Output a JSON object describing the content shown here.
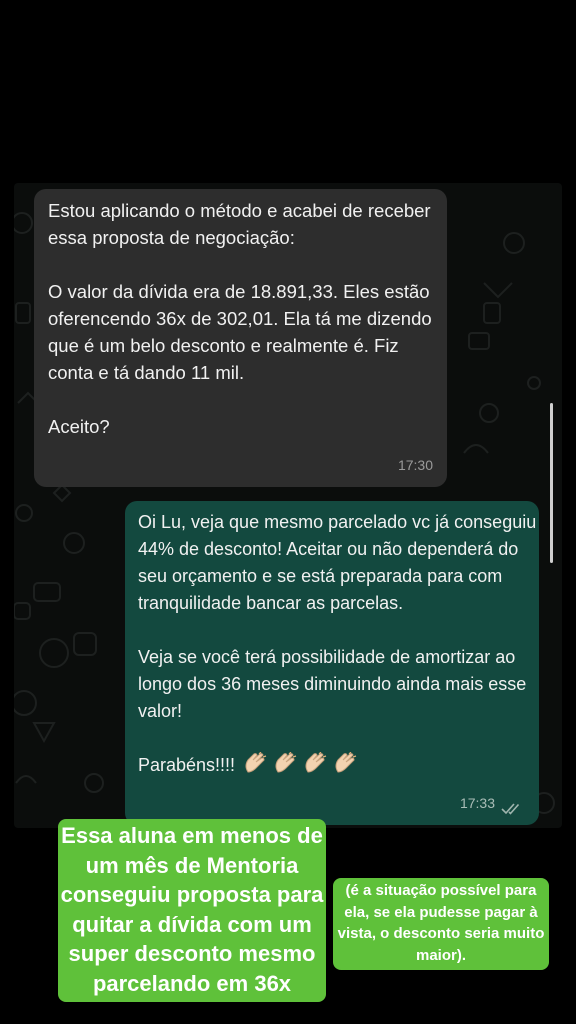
{
  "chat": {
    "incoming": {
      "text": "Estou aplicando o método e acabei de receber essa proposta de negociação:\n\nO valor da dívida era de 18.891,33. Eles estão oferencendo 36x de 302,01. Ela tá me dizendo que é um belo desconto e realmente é. Fiz conta e tá dando 11 mil.\n\nAceito?",
      "time": "17:30"
    },
    "outgoing": {
      "text": "Oi Lu, veja que mesmo parcelado vc já conseguiu 44% de desconto! Aceitar ou não dependerá do seu orçamento e se está preparada para com tranquilidade bancar as parcelas.\n\nVeja se você terá possibilidade de amortizar ao longo dos 36 meses diminuindo ainda mais esse valor!\n\nParabéns!!!!",
      "emoji": "clapping-hands-icon",
      "time": "17:33",
      "status_icon": "double-check-icon"
    }
  },
  "captions": {
    "main": "Essa aluna em menos de um mês de Mentoria conseguiu proposta para quitar a dívida com um super desconto mesmo parcelando em 36x",
    "side": "(é a situação possível para ela, se ela pudesse pagar à vista, o desconto seria muito maior)."
  },
  "colors": {
    "incoming_bubble": "#2d2d2d",
    "outgoing_bubble": "#13493f",
    "caption_bg": "#5fc13a"
  }
}
